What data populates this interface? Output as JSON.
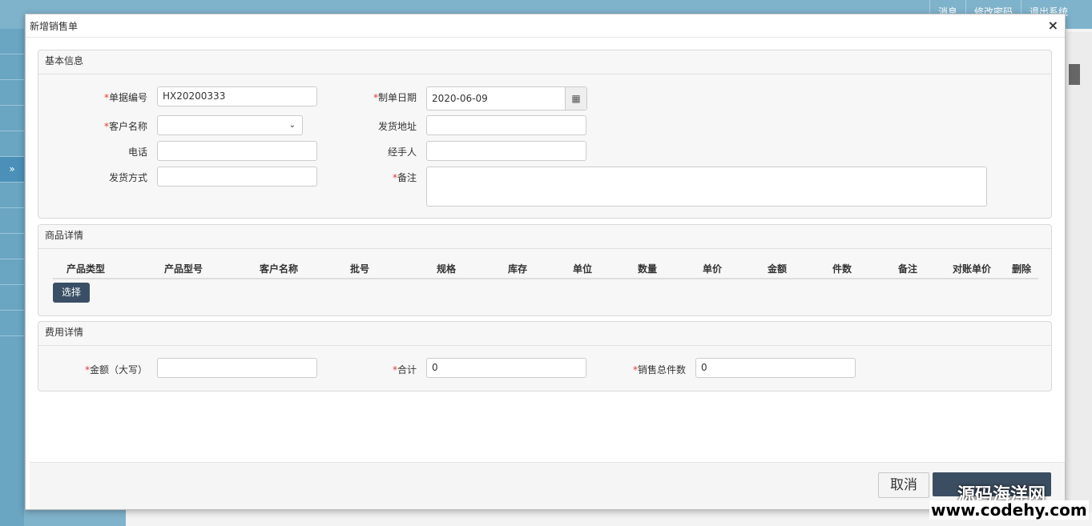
{
  "background": {
    "top_nav": [
      "消息",
      "修改密码",
      "退出系统"
    ],
    "sidebar_active_icon": "»",
    "cancel_label": "取消"
  },
  "watermark": {
    "line1": "源码海洋网",
    "line2": "www.codehy.com"
  },
  "modal": {
    "title": "新增销售单",
    "close_icon": "×"
  },
  "basic_info": {
    "heading": "基本信息",
    "doc_no_label": "单据编号",
    "doc_no_value": "HX20200333",
    "date_label": "制单日期",
    "date_value": "2020-06-09",
    "customer_label": "客户名称",
    "customer_value": "",
    "ship_addr_label": "发货地址",
    "ship_addr_value": "",
    "phone_label": "电话",
    "phone_value": "",
    "handler_label": "经手人",
    "handler_value": "",
    "ship_method_label": "发货方式",
    "ship_method_value": "",
    "remark_label": "备注",
    "remark_value": ""
  },
  "goods": {
    "heading": "商品详情",
    "columns": [
      "产品类型",
      "产品型号",
      "客户名称",
      "批号",
      "规格",
      "库存",
      "单位",
      "数量",
      "单价",
      "金额",
      "件数",
      "备注",
      "对账单价",
      "删除"
    ],
    "select_button": "选择"
  },
  "fees": {
    "heading": "费用详情",
    "amount_label": "金额（大写）",
    "amount_value": "",
    "total_label": "合计",
    "total_value": "0",
    "qty_label": "销售总件数",
    "qty_value": "0"
  },
  "colors": {
    "accent": "#3a4f66",
    "required": "#e03c31",
    "backdrop": "#7fb3cc"
  }
}
